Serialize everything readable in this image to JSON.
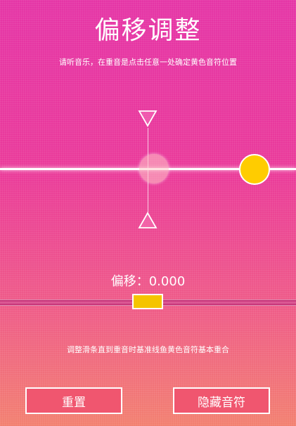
{
  "header": {
    "title": "偏移调整",
    "instruction": "请听音乐，在重音是点击任意一处确定黄色音符位置"
  },
  "offset": {
    "label": "偏移：",
    "value": "0.000"
  },
  "hint": "调整滑条直到重音时基准线鱼黄色音符基本重合",
  "buttons": {
    "reset": "重置",
    "hide_notes": "隐藏音符"
  },
  "colors": {
    "note": "#ffcc00",
    "slider_thumb": "#f5c400",
    "button_bg": "#f0566f",
    "background_top": "#e535a6",
    "background_bottom": "#f28070"
  },
  "icons": {
    "top_marker": "triangle-down-icon",
    "bottom_marker": "triangle-up-icon"
  }
}
